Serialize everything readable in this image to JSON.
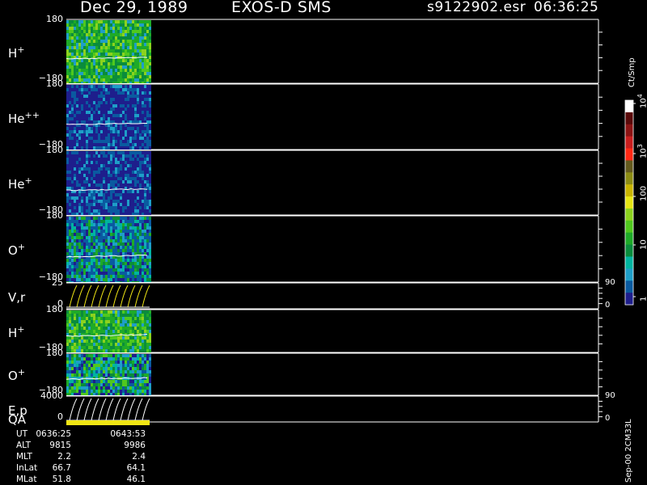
{
  "header": {
    "date": "Dec 29, 1989",
    "instrument": "EXOS-D SMS",
    "file": "s9122902.esr",
    "time": "06:36:25"
  },
  "chart_data": {
    "type": "heatmap",
    "panels": [
      {
        "label_main": "H",
        "label_sup": "+",
        "ytop": "180",
        "ybot": "−180",
        "kind": "spec",
        "palette": "green"
      },
      {
        "label_main": "He",
        "label_sup": "++",
        "ytop": "180",
        "ybot": "−180",
        "kind": "spec",
        "palette": "blue"
      },
      {
        "label_main": "He",
        "label_sup": "+",
        "ytop": "180",
        "ybot": "−180",
        "kind": "spec",
        "palette": "blue"
      },
      {
        "label_main": "O",
        "label_sup": "+",
        "ytop": "180",
        "ybot": "−180",
        "kind": "spec",
        "palette": "mixed"
      },
      {
        "label_main": "V,r",
        "label_sup": "",
        "ytop": "25",
        "ybot": "0",
        "kind": "line",
        "right_top": "90",
        "right_bot": "0"
      },
      {
        "label_main": "H",
        "label_sup": "+",
        "ytop": "180",
        "ybot": "−180",
        "kind": "spec",
        "palette": "green"
      },
      {
        "label_main": "O",
        "label_sup": "+",
        "ytop": "180",
        "ybot": "−180",
        "kind": "spec",
        "palette": "mixedgreen"
      },
      {
        "label_main": "E,p",
        "label_sup": "",
        "ytop": "4000",
        "ybot": "0",
        "kind": "line",
        "right_top": "90",
        "right_bot": "0"
      }
    ],
    "qa_label": "QA",
    "colorbar": {
      "unit": "Ct/Smp",
      "ticks": [
        {
          "base": "1",
          "exp": ""
        },
        {
          "base": "10",
          "exp": ""
        },
        {
          "base": "100",
          "exp": ""
        },
        {
          "base": "10",
          "exp": "3"
        },
        {
          "base": "10",
          "exp": "4"
        }
      ],
      "colors": [
        "#1e1e8c",
        "#0a5aa0",
        "#1e9ec8",
        "#00b4a0",
        "#0a8c3c",
        "#1eaa28",
        "#50c81e",
        "#8cd21e",
        "#e6e614",
        "#c8b400",
        "#8c8c14",
        "#645a1e",
        "#ff2814",
        "#c81e1e",
        "#8c1414",
        "#5a0a0a",
        "#ffffff"
      ]
    },
    "footer": {
      "rows": [
        {
          "name": "UT",
          "v1": "0636:25",
          "v2": "0643:53"
        },
        {
          "name": "ALT",
          "v1": "9815",
          "v2": "9986"
        },
        {
          "name": "MLT",
          "v1": "2.2",
          "v2": "2.4"
        },
        {
          "name": "InLat",
          "v1": "66.7",
          "v2": "64.1"
        },
        {
          "name": "MLat",
          "v1": "51.8",
          "v2": "46.1"
        }
      ],
      "vertical_text": "Sep-00 2CM33L"
    }
  }
}
